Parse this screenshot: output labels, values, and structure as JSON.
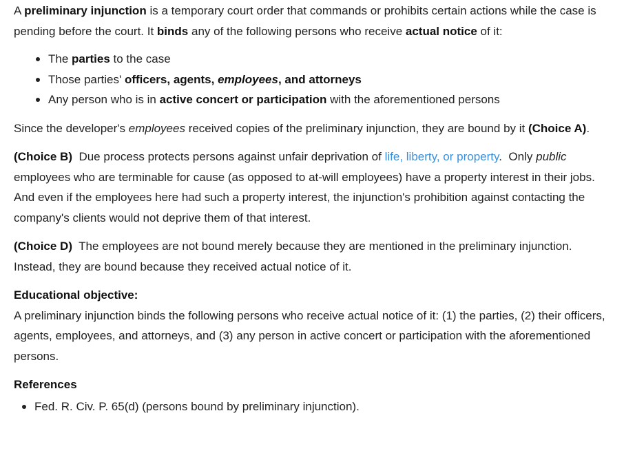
{
  "intro": {
    "s1": "A ",
    "b1": "preliminary injunction",
    "s2": " is a temporary court order that commands or prohibits certain actions while the case is pending before the court.  It ",
    "b2": "binds",
    "s3": " any of the following persons who receive ",
    "b3": "actual notice",
    "s4": " of it:"
  },
  "bullets": {
    "item1": {
      "pre": "The ",
      "bold": "parties",
      "post": " to the case"
    },
    "item2": {
      "pre": "Those parties' ",
      "bold_a": "officers, agents, ",
      "bold_i": "employees",
      "bold_b": ", and attorneys"
    },
    "item3": {
      "pre": "Any person who is in ",
      "bold": "active concert or participation",
      "post": " with the aforementioned persons"
    }
  },
  "choice_a": {
    "pre": "Since the developer's ",
    "italic": "employees",
    "mid": " received copies of the preliminary injunction, they are bound by it ",
    "bold": "(Choice A)",
    "post": "."
  },
  "choice_b": {
    "label": "(Choice B)",
    "s1": "  Due process protects persons against unfair deprivation of ",
    "link": "life, liberty, or property",
    "s2": ".  Only ",
    "italic": "public",
    "s3": " employees who are terminable for cause (as opposed to at-will employees) have a property interest in their jobs.  And even if the employees here had such a property interest, the injunction's prohibition against contacting the company's clients would not deprive them of that interest."
  },
  "choice_d": {
    "label": "(Choice D)",
    "text": "  The employees are not bound merely because they are mentioned in the preliminary injunction.  Instead, they are bound because they received actual notice of it."
  },
  "objective": {
    "heading": "Educational objective:",
    "text": "A preliminary injunction binds the following persons who receive actual notice of it: (1) the parties, (2) their officers, agents, employees, and attorneys, and (3) any person in active concert or participation with the aforementioned persons."
  },
  "references": {
    "heading": "References",
    "items": [
      "Fed. R. Civ. P. 65(d) (persons bound by preliminary injunction)."
    ]
  },
  "colors": {
    "text": "#222222",
    "link": "#3b8ed8",
    "background": "#ffffff"
  }
}
